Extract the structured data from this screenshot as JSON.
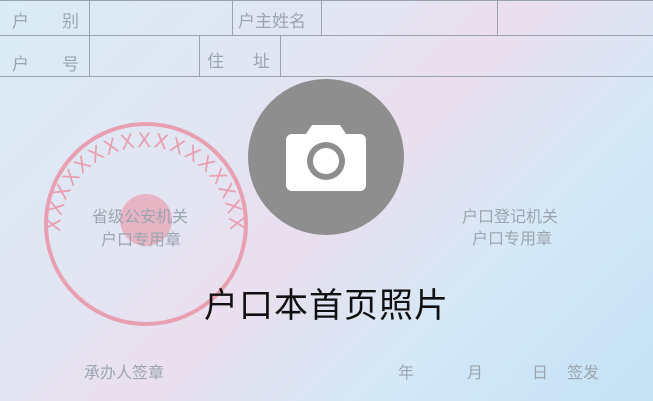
{
  "form": {
    "household_type_label": "户　别",
    "householder_name_label": "户主姓名",
    "household_number_label": "户　号",
    "address_label": "住　址"
  },
  "seals": {
    "public_security": {
      "line1": "省级公安机关",
      "line2": "户口专用章",
      "crosses": "XXXXXXXXXXXXXXXXX",
      "color": "#e8a0b0"
    },
    "registration": {
      "line1": "户口登记机关",
      "line2": "户口专用章"
    }
  },
  "footer": {
    "signer_label": "承办人签章",
    "year_label": "年",
    "month_label": "月",
    "day_label": "日",
    "issue_label": "签发"
  },
  "upload": {
    "icon": "camera-icon",
    "caption": "户口本首页照片"
  },
  "colors": {
    "upload_circle": "#8e8e8e",
    "label_text": "#9aa5af",
    "seal_red": "#e8a0b0"
  }
}
